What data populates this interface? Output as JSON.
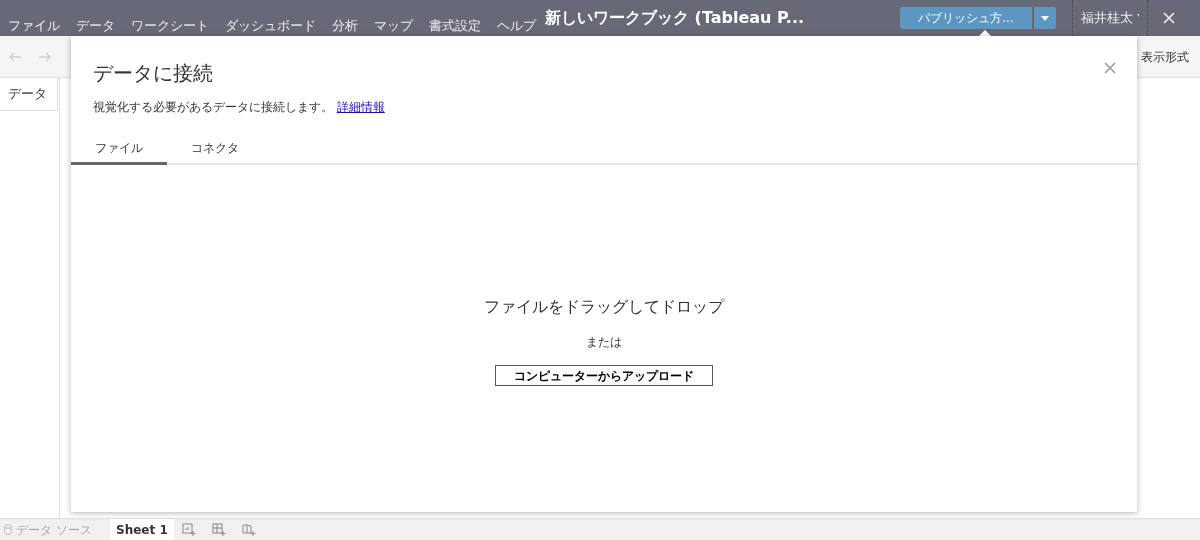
{
  "menu_bar": {
    "items": [
      "ファイル",
      "データ",
      "ワークシート",
      "ダッシュボード",
      "分析",
      "マップ",
      "書式設定",
      "ヘルプ"
    ],
    "title": "新しいワークブック (Tableau P...",
    "publish_button": "パブリッシュ方...",
    "user": "福井桂太"
  },
  "toolbar": {
    "format_label": "表示形式"
  },
  "side_panel": {
    "tab": "データ"
  },
  "dialog": {
    "title": "データに接続",
    "description": "視覚化する必要があるデータに接続します。",
    "link": "詳細情報",
    "tabs": [
      {
        "label": "ファイル",
        "selected": true
      },
      {
        "label": "コネクタ",
        "selected": false
      }
    ],
    "drop_text": "ファイルをドラッグしてドロップ",
    "or_text": "または",
    "upload_button": "コンピューターからアップロード"
  },
  "bottom_bar": {
    "data_source": "データ ソース",
    "sheets": [
      {
        "label": "Sheet 1",
        "selected": true
      }
    ]
  }
}
